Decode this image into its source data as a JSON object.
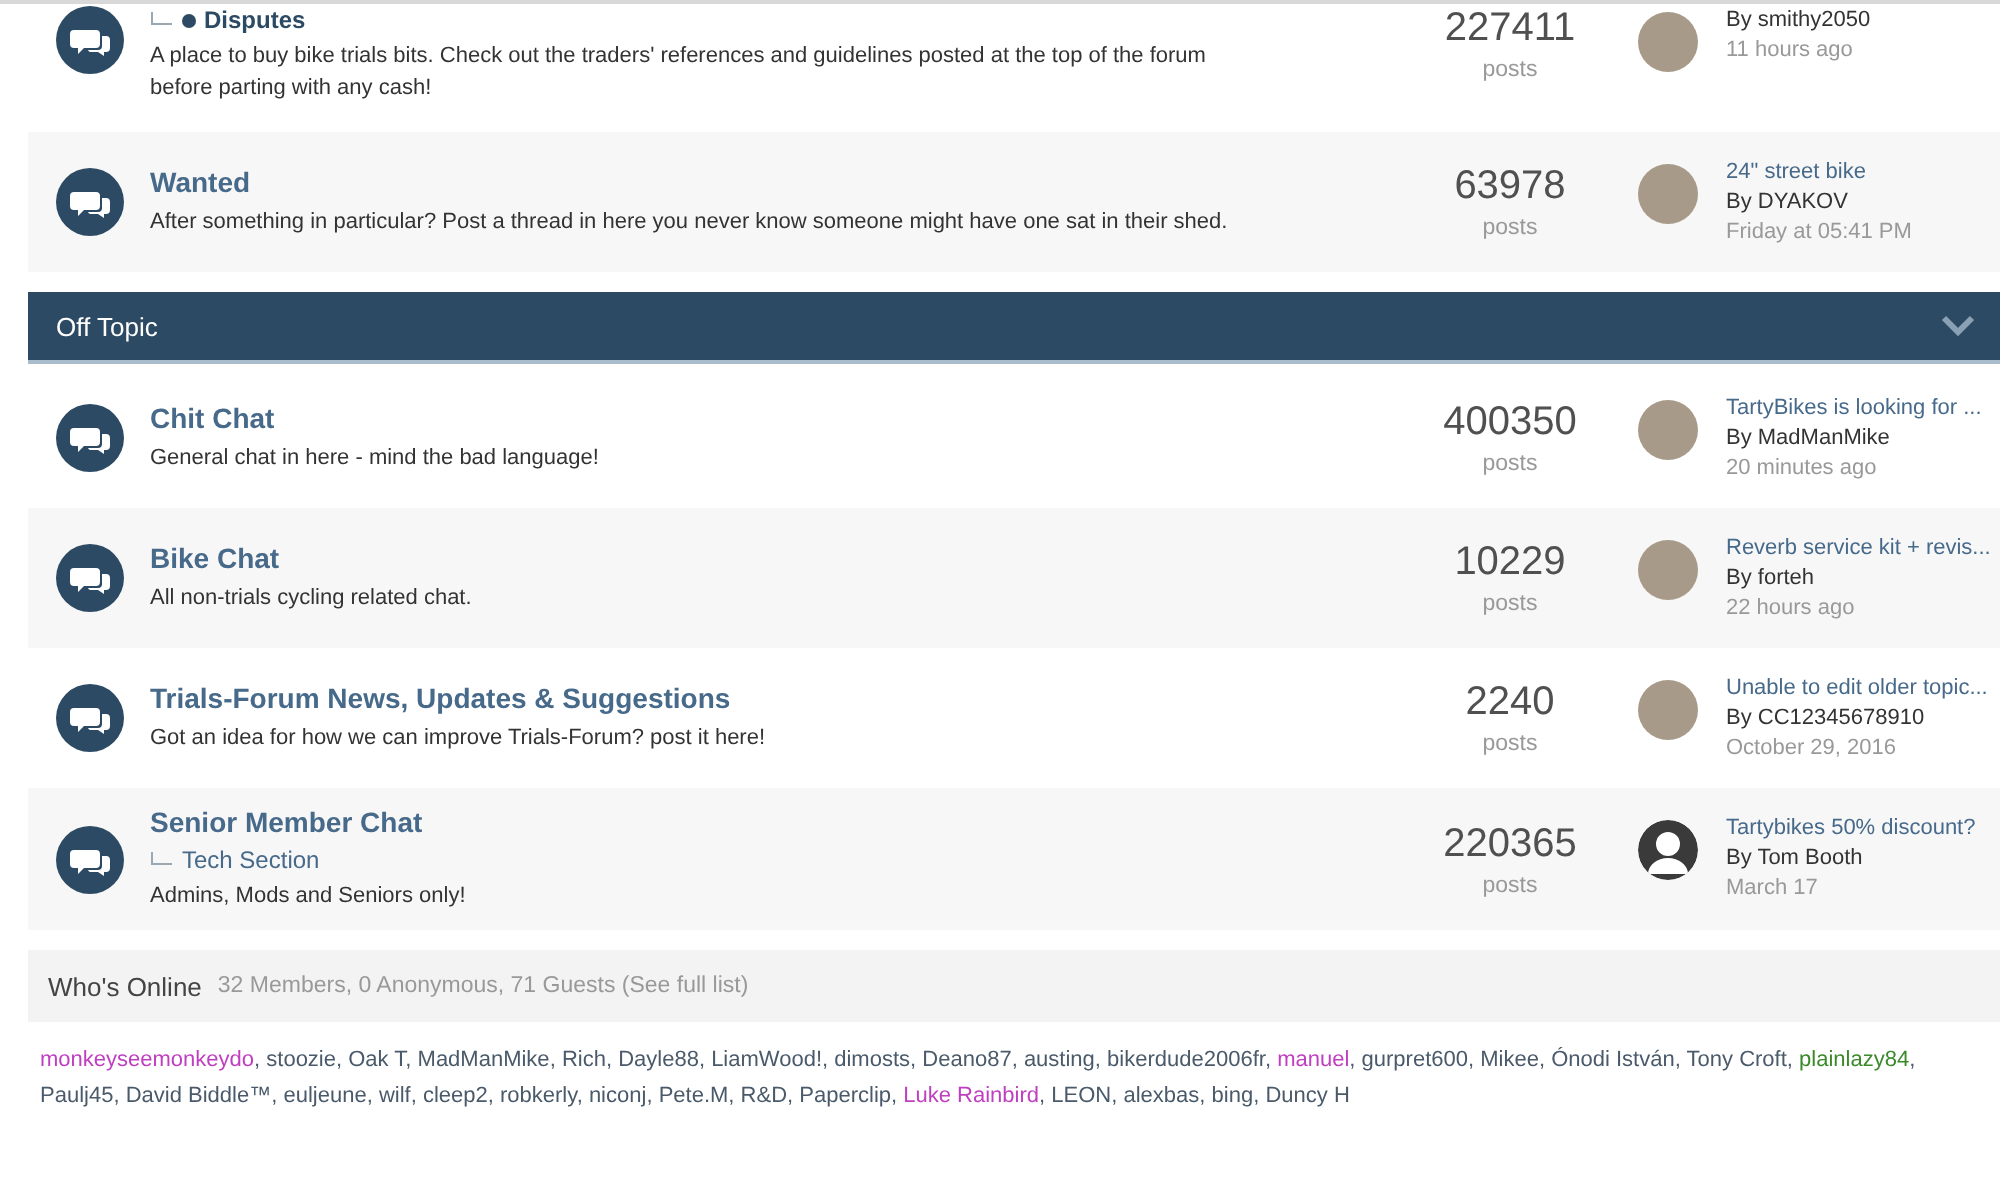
{
  "sections": [
    {
      "forums": [
        {
          "subforums": [
            {
              "label": "Disputes",
              "unread": true
            }
          ],
          "description": "A place to buy bike trials bits. Check out the traders' references and guidelines posted at the top of the forum before parting with any cash!",
          "count": "227411",
          "count_label": "posts",
          "last_post": {
            "by": "By smithy2050",
            "time": "11 hours ago",
            "default_avatar": false
          }
        },
        {
          "title": "Wanted",
          "description": "After something in particular? Post a thread in here you never know someone might have one sat in their shed.",
          "count": "63978",
          "count_label": "posts",
          "last_post": {
            "title": "24\" street bike",
            "by": "By DYAKOV",
            "time": "Friday at 05:41 PM",
            "default_avatar": false
          }
        }
      ]
    },
    {
      "header": {
        "title": "Off Topic",
        "expanded": true
      },
      "forums": [
        {
          "title": "Chit Chat",
          "description": "General chat in here - mind the bad language!",
          "count": "400350",
          "count_label": "posts",
          "last_post": {
            "title": "TartyBikes is looking for ...",
            "by": "By MadManMike",
            "time": "20 minutes ago",
            "default_avatar": false
          }
        },
        {
          "title": "Bike Chat",
          "description": "All non-trials cycling related chat.",
          "count": "10229",
          "count_label": "posts",
          "last_post": {
            "title": "Reverb service kit + revis...",
            "by": "By forteh",
            "time": "22 hours ago",
            "default_avatar": false
          }
        },
        {
          "title": "Trials-Forum News, Updates & Suggestions",
          "description": "Got an idea for how we can improve Trials-Forum? post it here!",
          "count": "2240",
          "count_label": "posts",
          "last_post": {
            "title": "Unable to edit older topic...",
            "by": "By CC12345678910",
            "time": "October 29, 2016",
            "default_avatar": false
          }
        },
        {
          "title": "Senior Member Chat",
          "subforums": [
            {
              "label": "Tech Section",
              "unread": false
            }
          ],
          "description": "Admins, Mods and Seniors only!",
          "count": "220365",
          "count_label": "posts",
          "last_post": {
            "title": "Tartybikes 50% discount?",
            "by": "By Tom Booth",
            "time": "March 17",
            "default_avatar": true
          }
        }
      ]
    }
  ],
  "whos_online": {
    "title": "Who's Online",
    "summary": "32 Members, 0 Anonymous, 71 Guests (See full list)",
    "separator": ",",
    "members": [
      {
        "name": "monkeyseemonkeydo",
        "color": "#c03ec0"
      },
      {
        "name": "stoozie",
        "color": "#4a5a6a"
      },
      {
        "name": "Oak T",
        "color": "#4a5a6a"
      },
      {
        "name": "MadManMike",
        "color": "#4a5a6a"
      },
      {
        "name": "Rich",
        "color": "#4a5a6a"
      },
      {
        "name": "Dayle88",
        "color": "#4a5a6a"
      },
      {
        "name": "LiamWood!",
        "color": "#4a5a6a"
      },
      {
        "name": "dimosts",
        "color": "#4a5a6a"
      },
      {
        "name": "Deano87",
        "color": "#4a5a6a"
      },
      {
        "name": "austing",
        "color": "#4a5a6a"
      },
      {
        "name": "bikerdude2006fr",
        "color": "#4a5a6a"
      },
      {
        "name": "manuel",
        "color": "#c03ec0"
      },
      {
        "name": "gurpret600",
        "color": "#4a5a6a"
      },
      {
        "name": "Mikee",
        "color": "#4a5a6a"
      },
      {
        "name": "Ónodi István",
        "color": "#4a5a6a"
      },
      {
        "name": "Tony Croft",
        "color": "#4a5a6a"
      },
      {
        "name": "plainlazy84",
        "color": "#3a8a2a"
      },
      {
        "name": "Paulj45",
        "color": "#4a5a6a"
      },
      {
        "name": "David Biddle™",
        "color": "#4a5a6a"
      },
      {
        "name": "euljeune",
        "color": "#4a5a6a"
      },
      {
        "name": "wilf",
        "color": "#4a5a6a"
      },
      {
        "name": "cleep2",
        "color": "#4a5a6a"
      },
      {
        "name": "robkerly",
        "color": "#4a5a6a"
      },
      {
        "name": "niconj",
        "color": "#4a5a6a"
      },
      {
        "name": "Pete.M",
        "color": "#4a5a6a"
      },
      {
        "name": "R&D",
        "color": "#4a5a6a"
      },
      {
        "name": "Paperclip",
        "color": "#4a5a6a"
      },
      {
        "name": "Luke Rainbird",
        "color": "#c03ec0"
      },
      {
        "name": "LEON",
        "color": "#4a5a6a"
      },
      {
        "name": "alexbas",
        "color": "#4a5a6a"
      },
      {
        "name": "bing",
        "color": "#4a5a6a"
      },
      {
        "name": "Duncy H",
        "color": "#4a5a6a"
      }
    ]
  }
}
